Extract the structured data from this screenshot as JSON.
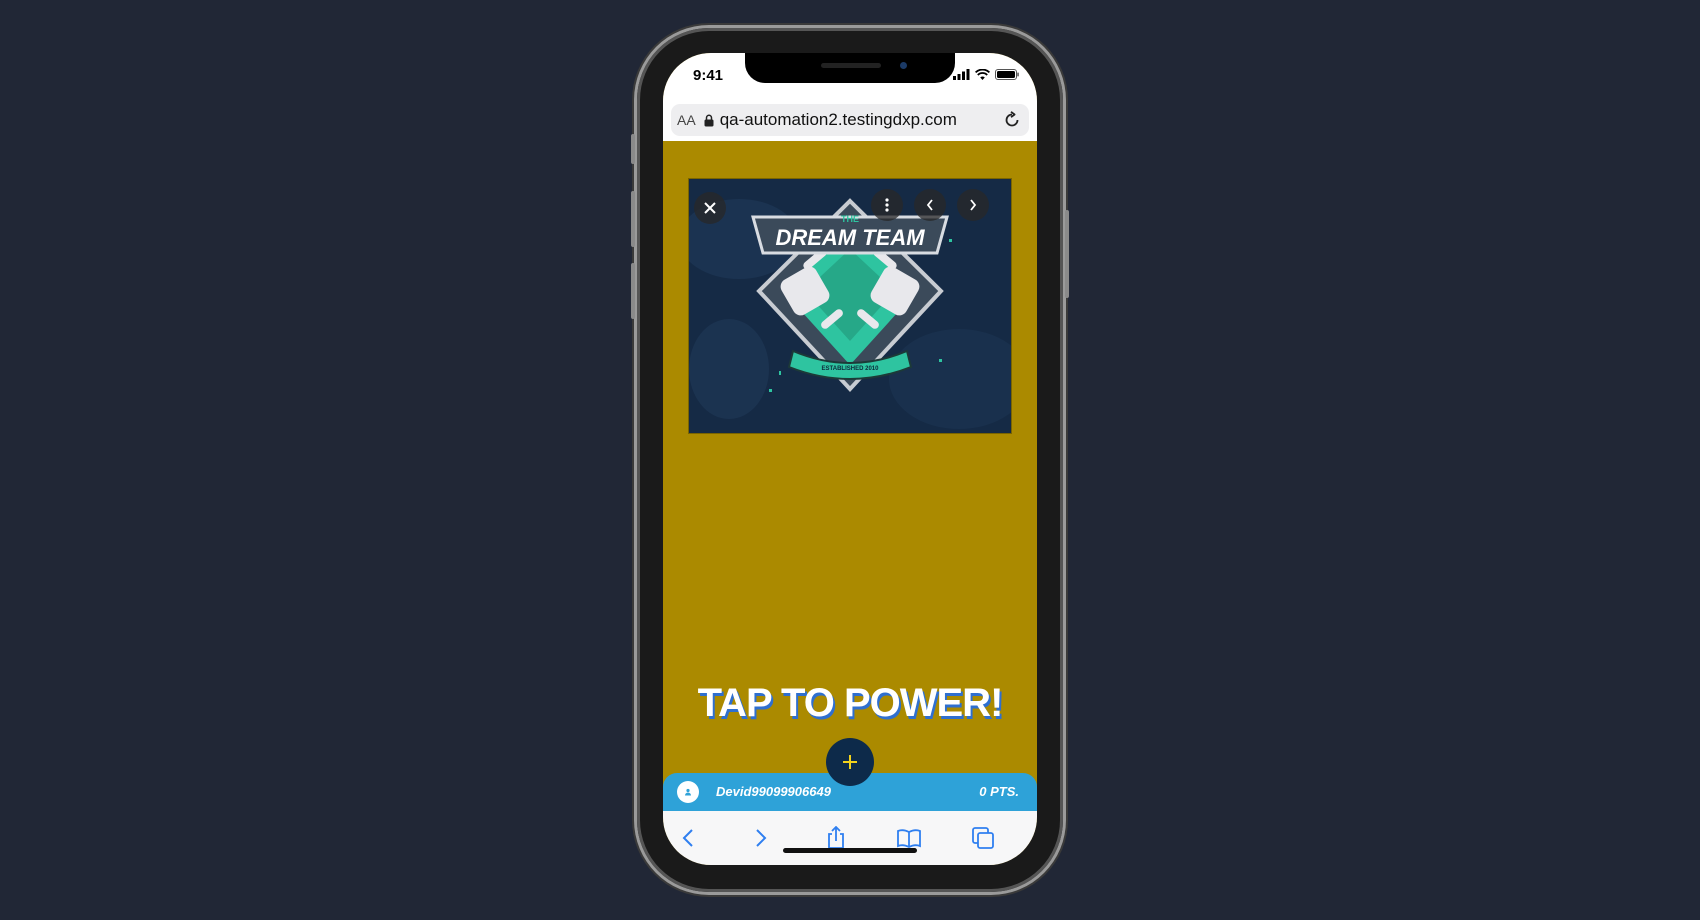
{
  "status_bar": {
    "time": "9:41"
  },
  "browser": {
    "text_size_label": "AA",
    "url": "qa-automation2.testingdxp.com"
  },
  "media": {
    "logo_top": "THE",
    "logo_title": "DREAM TEAM",
    "logo_ribbon": "ESTABLISHED 2010",
    "controls": [
      "close-icon",
      "more-icon",
      "chevron-left-icon",
      "chevron-right-icon"
    ]
  },
  "main": {
    "cta": "TAP TO POWER!"
  },
  "points_bar": {
    "username": "Devid99099906649",
    "points": "0 PTS."
  },
  "colors": {
    "page_bg": "#212736",
    "content_bg": "#ab8a00",
    "points_bar": "#2ea2d8",
    "plus_button": "#0d2a4a",
    "accent_teal": "#2ec4a0",
    "safari_blue": "#2f7ff0"
  }
}
